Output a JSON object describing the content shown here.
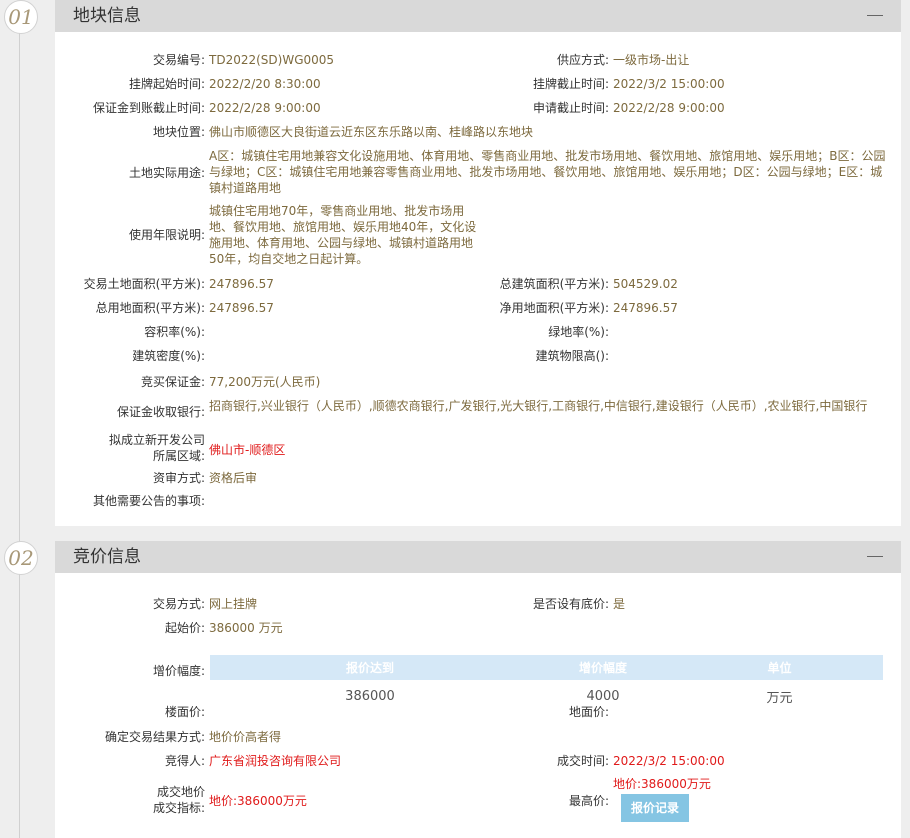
{
  "section1": {
    "number": "01",
    "title": "地块信息",
    "fields": {
      "trade_no": {
        "label": "交易编号:",
        "value": "TD2022(SD)WG0005"
      },
      "supply": {
        "label": "供应方式:",
        "value": "一级市场-出让"
      },
      "list_start": {
        "label": "挂牌起始时间:",
        "value": "2022/2/20 8:30:00"
      },
      "list_end": {
        "label": "挂牌截止时间:",
        "value": "2022/3/2 15:00:00"
      },
      "deposit_deadline": {
        "label": "保证金到账截止时间:",
        "value": "2022/2/28 9:00:00"
      },
      "apply_deadline": {
        "label": "申请截止时间:",
        "value": "2022/2/28 9:00:00"
      },
      "location": {
        "label": "地块位置:",
        "value": "佛山市顺德区大良街道云近东区东乐路以南、桂峰路以东地块"
      },
      "land_use": {
        "label": "土地实际用途:",
        "value": "A区：城镇住宅用地兼容文化设施用地、体育用地、零售商业用地、批发市场用地、餐饮用地、旅馆用地、娱乐用地；B区：公园与绿地；C区：城镇住宅用地兼容零售商业用地、批发市场用地、餐饮用地、旅馆用地、娱乐用地；D区：公园与绿地；E区：城镇村道路用地"
      },
      "use_years": {
        "label": "使用年限说明:",
        "value": "城镇住宅用地70年，零售商业用地、批发市场用地、餐饮用地、旅馆用地、娱乐用地40年，文化设施用地、体育用地、公园与绿地、城镇村道路用地50年，均自交地之日起计算。"
      },
      "trade_area": {
        "label": "交易土地面积(平方米):",
        "value": "247896.57"
      },
      "total_build_area": {
        "label": "总建筑面积(平方米):",
        "value": "504529.02"
      },
      "total_use_area": {
        "label": "总用地面积(平方米):",
        "value": "247896.57"
      },
      "net_use_area": {
        "label": "净用地面积(平方米):",
        "value": "247896.57"
      },
      "plot_ratio": {
        "label": "容积率(%):",
        "value": ""
      },
      "green_ratio": {
        "label": "绿地率(%):",
        "value": ""
      },
      "build_density": {
        "label": "建筑密度(%):",
        "value": ""
      },
      "height_limit": {
        "label": "建筑物限高():",
        "value": ""
      },
      "bid_deposit": {
        "label": "竞买保证金:",
        "value": "77,200万元(人民币)"
      },
      "deposit_banks": {
        "label": "保证金收取银行:",
        "value": "招商银行,兴业银行（人民币）,顺德农商银行,广发银行,光大银行,工商银行,中信银行,建设银行（人民币）,农业银行,中国银行"
      },
      "new_company_l1": "拟成立新开发公司",
      "new_company_l2": "所属区域:",
      "new_company_value": "佛山市-顺德区",
      "review": {
        "label": "资审方式:",
        "value": "资格后审"
      },
      "other": {
        "label": "其他需要公告的事项:",
        "value": ""
      }
    }
  },
  "section2": {
    "number": "02",
    "title": "竞价信息",
    "fields": {
      "trade_method": {
        "label": "交易方式:",
        "value": "网上挂牌"
      },
      "reserve": {
        "label": "是否设有底价:",
        "value": "是"
      },
      "start_price": {
        "label": "起始价:",
        "value": "386000 万元"
      },
      "increment_label": "增价幅度:",
      "table": {
        "headers": [
          "报价达到",
          "增价幅度",
          "单位"
        ],
        "rows": [
          [
            "386000",
            "4000",
            "万元"
          ]
        ]
      },
      "floor_price": {
        "label": "楼面价:",
        "value": ""
      },
      "land_price": {
        "label": "地面价:",
        "value": ""
      },
      "result_method": {
        "label": "确定交易结果方式:",
        "value": "地价价高者得"
      },
      "winner": {
        "label": "竞得人:",
        "value": "广东省润投咨询有限公司"
      },
      "deal_time": {
        "label": "成交时间:",
        "value": "2022/3/2 15:00:00"
      },
      "deal_l1": "成交地价",
      "deal_l2": "成交指标:",
      "deal_value": "地价:386000万元",
      "highest_label": "最高价:",
      "highest_value": "地价:386000万元",
      "quote_btn": "报价记录"
    }
  }
}
